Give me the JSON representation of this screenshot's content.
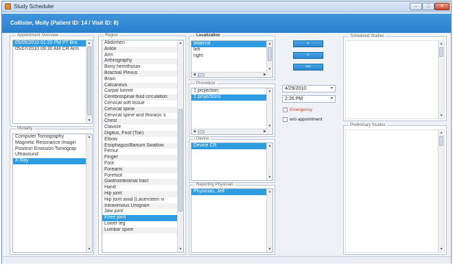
{
  "window": {
    "title": "Study Scheduler",
    "minimize_glyph": "–",
    "maximize_glyph": "□",
    "close_glyph": "✕"
  },
  "header": {
    "patient_name": "Collister, Molly  (Patient ID: 14 / Visit ID: 8)"
  },
  "appointment_overview": {
    "label": "Appointment Overview",
    "items": [
      {
        "text": "05/05/2010 01:20 PM PT Bra",
        "selected": true
      },
      {
        "text": "05/07/2010 09:30 AM CR Arm",
        "selected": false
      }
    ]
  },
  "modality": {
    "label": "Modality",
    "items": [
      {
        "text": "Computer Tomography",
        "selected": false
      },
      {
        "text": "Magnetic Resonance Imagin",
        "selected": false
      },
      {
        "text": "Positron Emission Tomograp",
        "selected": false
      },
      {
        "text": "Ultrasound",
        "selected": false
      },
      {
        "text": "X-Ray",
        "selected": true
      }
    ]
  },
  "region": {
    "label": "Region",
    "items": [
      {
        "text": "Abdomen",
        "selected": false
      },
      {
        "text": "Ankle",
        "selected": false
      },
      {
        "text": "Arm",
        "selected": false
      },
      {
        "text": "Arthrography",
        "selected": false
      },
      {
        "text": "Bony hemithorax",
        "selected": false
      },
      {
        "text": "Brachial Plexus",
        "selected": false
      },
      {
        "text": "Brain",
        "selected": false
      },
      {
        "text": "Calcaneus",
        "selected": false
      },
      {
        "text": "Carpal tunnel",
        "selected": false
      },
      {
        "text": "Cerebrospinal fluid circulation",
        "selected": false
      },
      {
        "text": "Cervical soft tissue",
        "selected": false
      },
      {
        "text": "Cervical spine",
        "selected": false
      },
      {
        "text": "Cervical spine and thoracic s",
        "selected": false
      },
      {
        "text": "Chest",
        "selected": false
      },
      {
        "text": "Clavicle",
        "selected": false
      },
      {
        "text": "Digitus, Foot (Toe)",
        "selected": false
      },
      {
        "text": "Elbow",
        "selected": false
      },
      {
        "text": "Esophagus/Barium Swallow",
        "selected": false
      },
      {
        "text": "Femur",
        "selected": false
      },
      {
        "text": "Finger",
        "selected": false
      },
      {
        "text": "Foot",
        "selected": false
      },
      {
        "text": "Forearm",
        "selected": false
      },
      {
        "text": "Forefoot",
        "selected": false
      },
      {
        "text": "Gastrointestinal tract",
        "selected": false
      },
      {
        "text": "Hand",
        "selected": false
      },
      {
        "text": "Hip joint",
        "selected": false
      },
      {
        "text": "Hip joint axial (Lauenstein vi",
        "selected": false
      },
      {
        "text": "Intravenous Urogram",
        "selected": false
      },
      {
        "text": "Jaw joint",
        "selected": false
      },
      {
        "text": "Knee joint",
        "selected": true
      },
      {
        "text": "Lower leg",
        "selected": false
      },
      {
        "text": "Lumbar spine",
        "selected": false
      }
    ]
  },
  "localization": {
    "label": "Localization",
    "items": [
      {
        "text": "bilateral",
        "selected": true
      },
      {
        "text": "left",
        "selected": false
      },
      {
        "text": "right",
        "selected": false
      }
    ]
  },
  "procedure": {
    "label": "Procedure",
    "items": [
      {
        "text": "1 projection",
        "selected": false
      },
      {
        "text": "2 projections",
        "selected": true
      }
    ]
  },
  "device": {
    "label": "Device",
    "items": [
      {
        "text": "Device CR",
        "selected": true
      }
    ]
  },
  "reporting_physician": {
    "label": "Reporting Physician",
    "items": [
      {
        "text": "Physician, Jeff",
        "selected": true
      }
    ]
  },
  "actions": {
    "add_label": ">",
    "remove_label": "<",
    "remove_all_label": "<<"
  },
  "schedule": {
    "date_value": "4/29/2010",
    "time_value": "2:26 PM",
    "emergency_label": "Emergency",
    "no_appointment_label": "w/o appointment",
    "dropdown_glyph": "▼"
  },
  "scheduled_studies": {
    "label": "Scheduled Studies"
  },
  "preliminary_studies": {
    "label": "Preliminary Studies"
  },
  "colors": {
    "header_blue": "#2a7fcd",
    "selection_blue": "#2f9be0",
    "emergency_red": "#d23b2b"
  }
}
